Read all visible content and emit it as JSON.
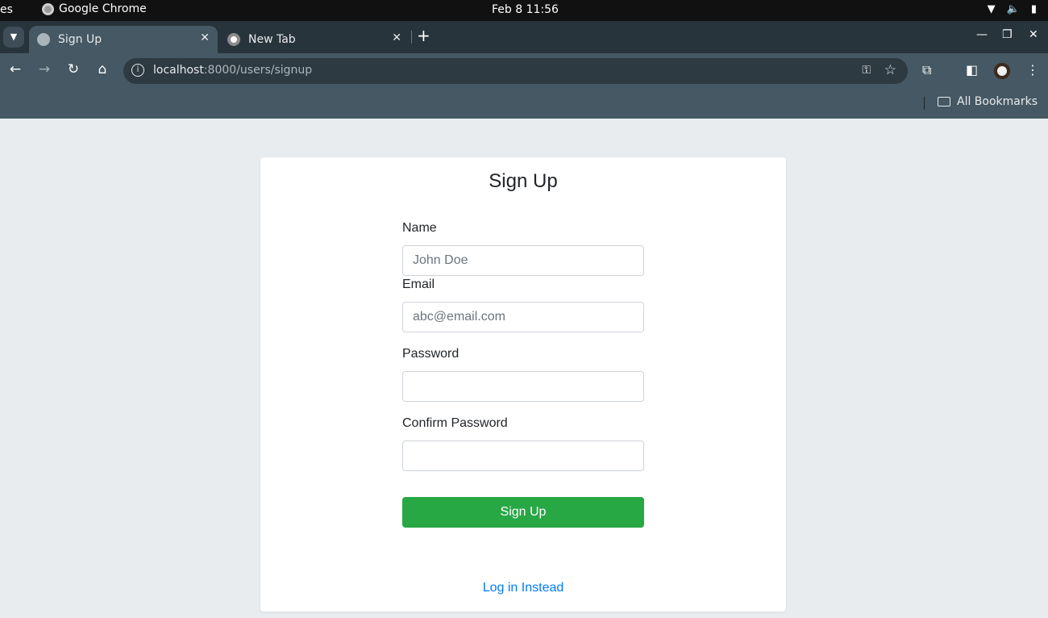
{
  "os": {
    "activities_text": "es",
    "app_name": "Google Chrome",
    "datetime": "Feb 8  11:56"
  },
  "browser": {
    "tabs": [
      {
        "title": "Sign Up",
        "active": true
      },
      {
        "title": "New Tab",
        "active": false
      }
    ],
    "url_host": "localhost",
    "url_path": ":8000/users/signup",
    "bookmarks_label": "All Bookmarks"
  },
  "form": {
    "title": "Sign Up",
    "name_label": "Name",
    "name_placeholder": "John Doe",
    "email_label": "Email",
    "email_placeholder": "abc@email.com",
    "password_label": "Password",
    "confirm_label": "Confirm Password",
    "submit_label": "Sign Up",
    "login_link": "Log in Instead"
  },
  "colors": {
    "submit_bg": "#28a745",
    "link": "#007bff",
    "page_bg": "#e9ecef"
  }
}
